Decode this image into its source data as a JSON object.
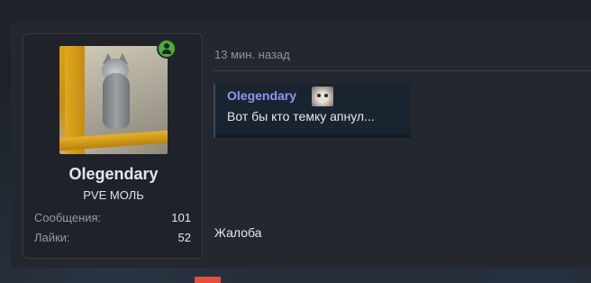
{
  "user": {
    "name": "Olegendary",
    "title": "PVE МОЛЬ",
    "online": true,
    "stats": [
      {
        "label": "Сообщения:",
        "value": "101"
      },
      {
        "label": "Лайки:",
        "value": "52"
      }
    ]
  },
  "post": {
    "time": "13 мин. назад",
    "quote": {
      "author": "Olegendary",
      "text": "Вот бы кто темку апнул..."
    },
    "report_label": "Жалоба"
  },
  "colors": {
    "online": "#4caf34",
    "quote_author": "#8e97f2",
    "accent_badge": "#e0503a"
  },
  "icons": {
    "online_status": "user-online-icon",
    "quote_emoji": "cat-emoji-icon"
  }
}
